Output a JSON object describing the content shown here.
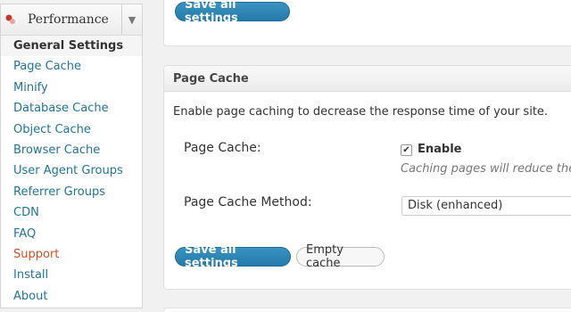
{
  "sidebar": {
    "title": "Performance",
    "toggle_icon": "triangle-down",
    "items": [
      {
        "label": "General Settings",
        "current": true
      },
      {
        "label": "Page Cache"
      },
      {
        "label": "Minify"
      },
      {
        "label": "Database Cache"
      },
      {
        "label": "Object Cache"
      },
      {
        "label": "Browser Cache"
      },
      {
        "label": "User Agent Groups"
      },
      {
        "label": "Referrer Groups"
      },
      {
        "label": "CDN"
      },
      {
        "label": "FAQ"
      },
      {
        "label": "Support",
        "highlight": true
      },
      {
        "label": "Install"
      },
      {
        "label": "About"
      }
    ]
  },
  "top": {
    "save_label": "Save all settings"
  },
  "page_cache": {
    "header": "Page Cache",
    "description": "Enable page caching to decrease the response time of your site.",
    "enable_row_label": "Page Cache:",
    "enable_checkbox_label": "Enable",
    "enable_checked": true,
    "enable_hint": "Caching pages will reduce the",
    "method_row_label": "Page Cache Method:",
    "method_value": "Disk (enhanced)",
    "save_label": "Save all settings",
    "empty_cache_label": "Empty cache"
  },
  "colors": {
    "link": "#21759b",
    "support": "#d54e21",
    "primary_button": "#2e86b4"
  }
}
